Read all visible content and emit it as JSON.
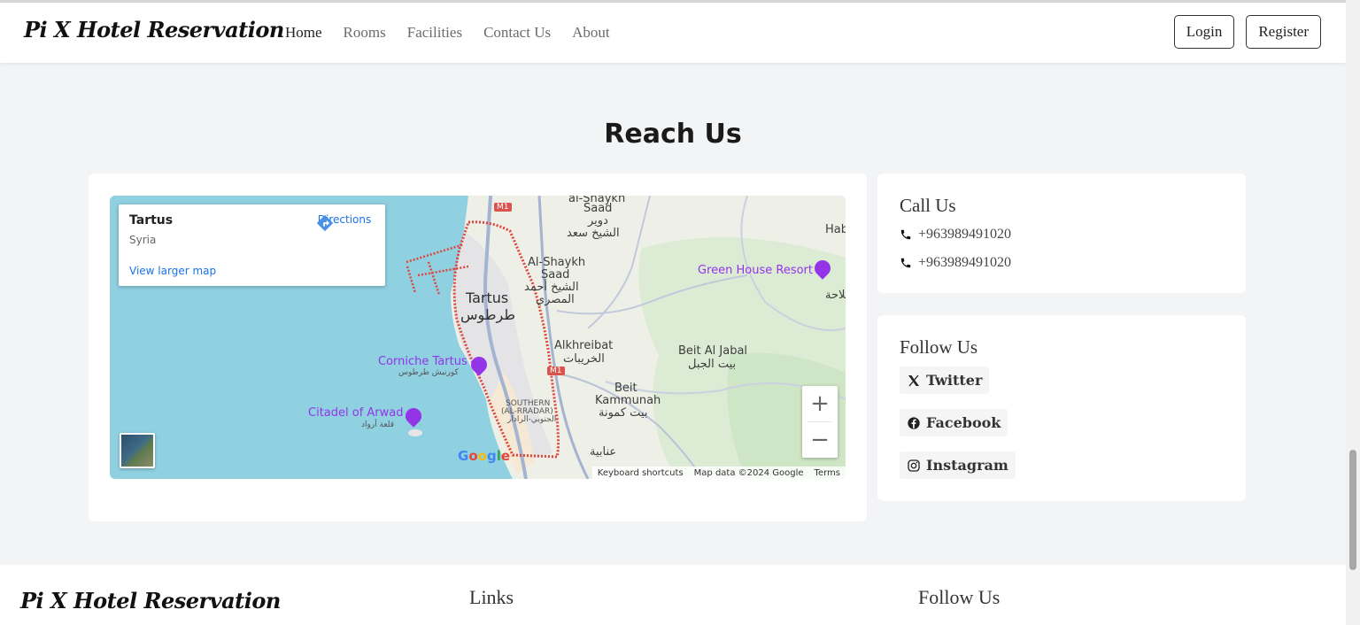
{
  "header": {
    "brand": "Pi X Hotel Reservation",
    "nav": [
      "Home",
      "Rooms",
      "Facilities",
      "Contact Us",
      "About"
    ],
    "login_label": "Login",
    "register_label": "Register"
  },
  "section": {
    "title": "Reach Us"
  },
  "map": {
    "place": "Tartus",
    "country": "Syria",
    "directions_label": "Directions",
    "larger_map_label": "View larger map",
    "zoom_in": "+",
    "zoom_out": "−",
    "footer": [
      "Keyboard shortcuts",
      "Map data ©2024 Google",
      "Terms"
    ],
    "labels": {
      "al_shaykh_top_en": "al-Shaykh",
      "saad_top": "Saad",
      "duwayr_ar": "دوير",
      "shaykh_saad_ar": "الشيخ سعد",
      "hab": "Hab",
      "al_shaykh_saad_en1": "Al-Shaykh",
      "al_shaykh_saad_en2": "Saad",
      "al_shaykh_ahmad_ar1": "الشيخ أحمد",
      "al_shaykh_ahmad_ar2": "المصري",
      "tartus_en": "Tartus",
      "tartus_ar": "طرطوس",
      "green_house": "Green House Resort",
      "salaha_ar": "ملاحة",
      "alkhreibat_en": "Alkhreibat",
      "alkhreibat_ar": "الخريبات",
      "beit_al_jabal_en": "Beit Al Jabal",
      "beit_al_jabal_ar": "بيت الجبل",
      "corniche_en": "Corniche Tartus",
      "corniche_ar": "كورنيش طرطوس",
      "beit_kammunah_en1": "Beit",
      "beit_kammunah_en2": "Kammunah",
      "beit_kammunah_ar": "بيت كمونة",
      "southern1": "SOUTHERN",
      "southern2": "(AL-RRADAR)",
      "southern_ar": "الجنوبي-الرادار",
      "citadel_en": "Citadel of Arwad",
      "citadel_ar": "قلعة أرواد",
      "anabiya_ar": "عنابية",
      "m1": "M1",
      "google": "Google"
    }
  },
  "call": {
    "title": "Call Us",
    "phones": [
      "+963989491020",
      "+963989491020"
    ]
  },
  "follow": {
    "title": "Follow Us",
    "links": [
      "Twitter",
      "Facebook",
      "Instagram"
    ]
  },
  "footer": {
    "brand": "Pi X Hotel Reservation",
    "links_heading": "Links",
    "follow_heading": "Follow Us"
  },
  "colors": {
    "water": "#8fd0e1",
    "land": "#eef0e8",
    "road": "#a4b4d0",
    "boundary": "#e0433a",
    "poi": "#9334e6",
    "link": "#1a73e8"
  }
}
